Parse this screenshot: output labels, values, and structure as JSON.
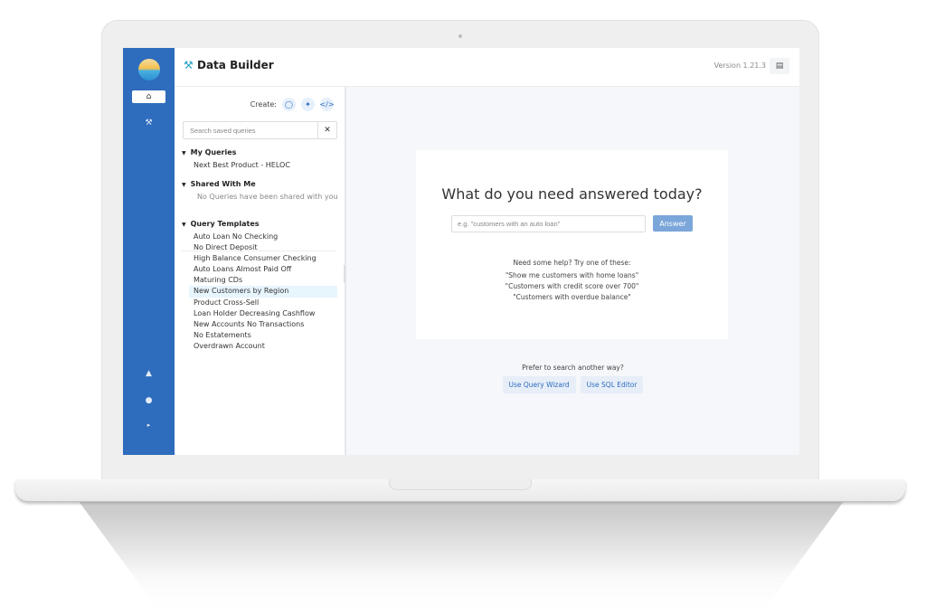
{
  "app": {
    "title": "Data Builder",
    "version": "Version 1.21.3"
  },
  "rail": {
    "icons": [
      "bank-icon",
      "wrench-icon",
      "bell-icon",
      "user-icon",
      "expand-icon"
    ],
    "bank_glyph": "🏛",
    "wrench_glyph": "🔧",
    "bell_glyph": "🔔",
    "user_glyph": "👤",
    "expand_glyph": "▸"
  },
  "sidebar": {
    "create_label": "Create:",
    "create_buttons": [
      "chat-icon",
      "wand-icon",
      "code-icon"
    ],
    "search_placeholder": "Search saved queries",
    "clear_glyph": "✕",
    "my_queries": {
      "title": "My Queries",
      "items": [
        "Next Best Product - HELOC"
      ]
    },
    "shared": {
      "title": "Shared With Me",
      "empty": "No Queries have been shared with you"
    },
    "templates": {
      "title": "Query Templates",
      "items": [
        "Auto Loan No Checking",
        "No Direct Deposit",
        "High Balance Consumer Checking",
        "Auto Loans Almost Paid Off",
        "Maturing CDs",
        "New Customers by Region",
        "Product Cross-Sell",
        "Loan Holder Decreasing Cashflow",
        "New Accounts No Transactions",
        "No Estatements",
        "Overdrawn Account"
      ],
      "selected": "New Customers by Region"
    }
  },
  "main": {
    "question": "What do you need answered today?",
    "input_placeholder": "e.g. \"customers with an auto loan\"",
    "input_value": "",
    "answer_label": "Answer",
    "help_title": "Need some help? Try one of these:",
    "suggestions": [
      "\"Show me customers with home loans\"",
      "\"Customers with credit score over 700\"",
      "\"Customers with overdue balance\""
    ],
    "prefer_label": "Prefer to search another way?",
    "wizard_label": "Use Query Wizard",
    "sql_label": "Use SQL Editor"
  },
  "colors": {
    "rail": "#2e6cbd",
    "accent": "#2aa3c9",
    "answer_button": "#7ba6d9",
    "selected_row": "#e7f5fd"
  }
}
